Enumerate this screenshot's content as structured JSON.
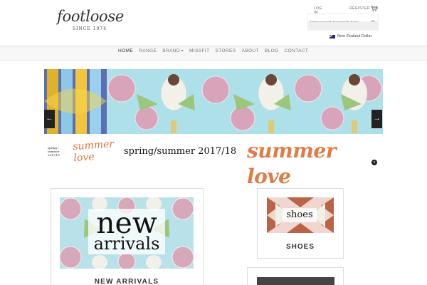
{
  "brand": {
    "logo_text": "footloose",
    "logo_since": "SINCE 1974"
  },
  "header": {
    "login": "LOG IN",
    "register": "REGISTER",
    "cart_count": "0",
    "search_placeholder": "Enter search keywords here",
    "currency": "New Zealand Dollar"
  },
  "nav": {
    "items": [
      {
        "label": "HOME",
        "active": true
      },
      {
        "label": "RANGE"
      },
      {
        "label": "BRAND"
      },
      {
        "label": "MISSFIT"
      },
      {
        "label": "STORES"
      },
      {
        "label": "ABOUT"
      },
      {
        "label": "BLOG"
      },
      {
        "label": "CONTACT"
      }
    ]
  },
  "slider": {
    "prev_label": "←",
    "next_label": "→",
    "pause_label": "II",
    "caption_small": "spring / summer 2017/18",
    "script_small": "summer love",
    "caption": "spring/summer 2017/18",
    "script": "summer love"
  },
  "products": {
    "new_arrivals": {
      "title_line1": "new",
      "title_line2": "arrivals",
      "label": "NEW ARRIVALS"
    },
    "shoes": {
      "title": "shoes",
      "label": "SHOES"
    }
  },
  "colors": {
    "accent_orange": "#e27a45",
    "nav_bg": "#f7f7f7",
    "slider_sky": "#aedfe9"
  },
  "icons": [
    "cart-icon",
    "search-icon",
    "nz-flag-icon",
    "arrow-left-icon",
    "arrow-right-icon",
    "pause-icon"
  ]
}
